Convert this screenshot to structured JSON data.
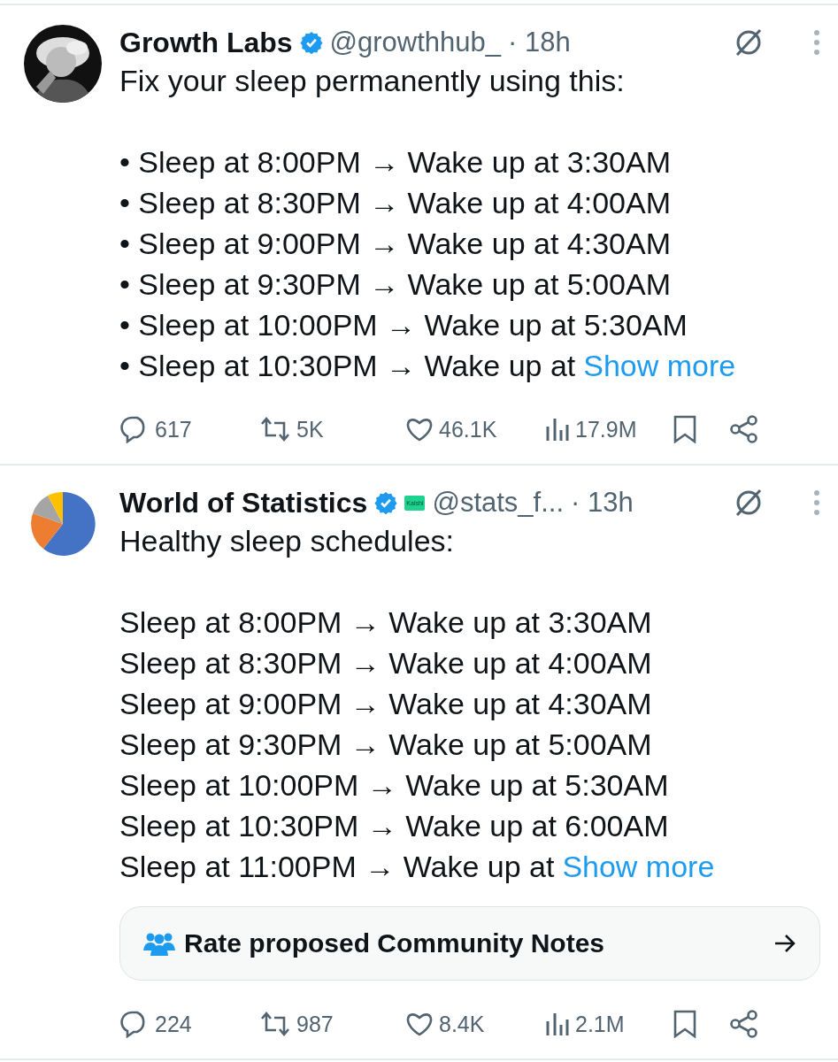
{
  "posts": [
    {
      "avatar": {
        "kind": "picture"
      },
      "name": "Growth Labs",
      "verified": true,
      "handle": "@growthhub_",
      "time": "· 18h",
      "text": "Fix your sleep permanently using this:",
      "lines": [
        "• Sleep at 8:00PM → Wake up at 3:30AM",
        "• Sleep at 8:30PM → Wake up at 4:00AM",
        "• Sleep at 9:00PM → Wake up at 4:30AM",
        "• Sleep at 9:30PM → Wake up at 5:00AM",
        "• Sleep at 10:00PM → Wake up at 5:30AM"
      ],
      "last_line": "• Sleep at 10:30PM → Wake up at",
      "show_more": "Show more",
      "replies": "617",
      "reposts": "5K",
      "likes": "46.1K",
      "views": "17.9M"
    },
    {
      "avatar": {
        "kind": "pie"
      },
      "name": "World of Statistics",
      "verified": true,
      "badge": "Kalshi",
      "handle": "@stats_f...",
      "time": "· 13h",
      "text": "Healthy sleep schedules:",
      "lines": [
        "Sleep at 8:00PM → Wake up at 3:30AM",
        "Sleep at 8:30PM → Wake up at 4:00AM",
        "Sleep at 9:00PM → Wake up at 4:30AM",
        "Sleep at 9:30PM → Wake up at 5:00AM",
        "Sleep at 10:00PM → Wake up at 5:30AM",
        "Sleep at 10:30PM → Wake up at 6:00AM"
      ],
      "last_line": "Sleep at 11:00PM → Wake up at",
      "show_more": "Show more",
      "notes_prompt": "Rate proposed Community Notes",
      "replies": "224",
      "reposts": "987",
      "likes": "8.4K",
      "views": "2.1M"
    }
  ]
}
